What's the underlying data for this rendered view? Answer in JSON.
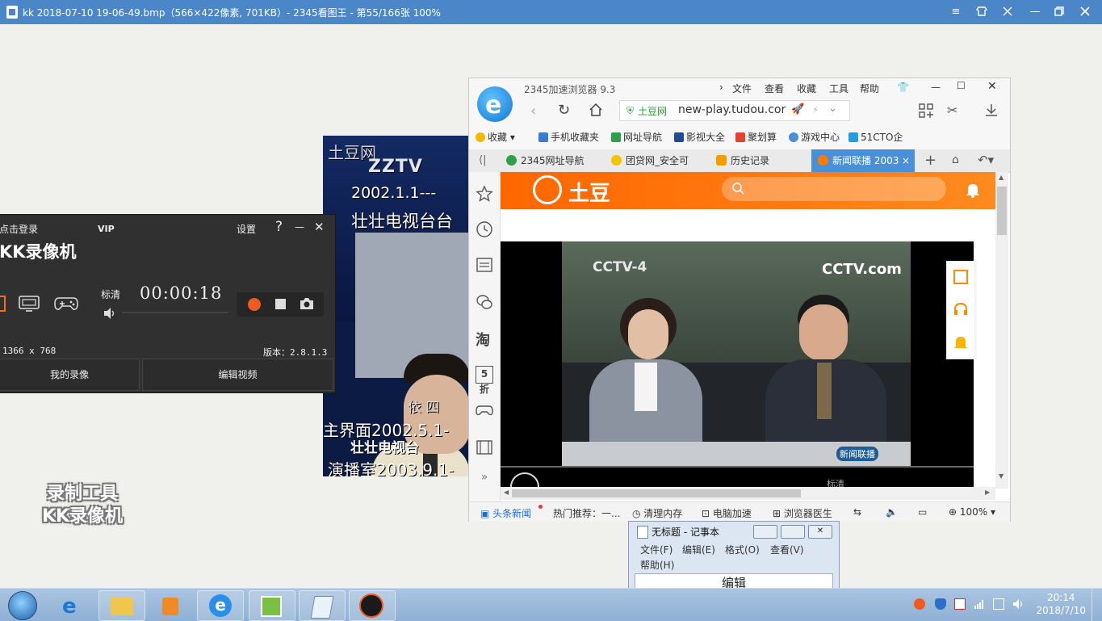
{
  "viewer": {
    "title": "kk 2018-07-10 19-06-49.bmp（566×422像素, 701KB）- 2345看图王 - 第55/166张 100%"
  },
  "zztv": {
    "logo_text": "土豆网",
    "channel_logo": "ZZTV",
    "line1": "2002.1.1---",
    "line2": "壮壮电视台台",
    "line3": "主界面2002.5.1-",
    "line4": "演播室2003.9.1-",
    "desk_sign": "壮壮电视台",
    "desk_name": "依 四"
  },
  "kk": {
    "login": "点击登录",
    "vip": "VIP",
    "settings": "设置",
    "help": "?",
    "minimize": "—",
    "close": "✕",
    "brand": "KK录像机",
    "quality": "标清",
    "timer": "00:00:18",
    "resolution": "1366 x 768",
    "version": "版本：2.8.1.3",
    "my_recordings": "我的录像",
    "edit_video": "编辑视频"
  },
  "watermark": {
    "line1": "录制工具",
    "line2": "KK录像机"
  },
  "browser": {
    "title": "2345加速浏览器 9.3",
    "menu": [
      "文件",
      "查看",
      "收藏",
      "工具",
      "帮助"
    ],
    "address_site": "土豆网",
    "address_url": "new-play.tudou.cor",
    "bookmarks": [
      "收藏",
      "手机收藏夹",
      "网址导航",
      "影视大全",
      "聚划算",
      "游戏中心",
      "51CTO企"
    ],
    "tabs": [
      "2345网址导航",
      "团贷网_安全可",
      "历史记录",
      "新闻联播 2003"
    ],
    "tudou_logo": "土豆",
    "video_logo_left": "CCTV-4",
    "video_logo_right": "CCTV.com",
    "video_caption": "新闻联播",
    "video_quality": "标清",
    "status": {
      "news": "头条新闻",
      "hot": "热门推荐：一...",
      "clean": "清理内存",
      "speedup": "电脑加速",
      "doctor": "浏览器医生",
      "zoom": "100%"
    }
  },
  "notepad": {
    "title": "无标题 - 记事本",
    "menu": [
      "文件(F)",
      "编辑(E)",
      "格式(O)",
      "查看(V)",
      "帮助(H)"
    ],
    "content": "编辑"
  },
  "taskbar": {
    "time": "20:14",
    "date": "2018/7/10"
  },
  "colors": {
    "viewer_title": "#4a86c8",
    "kk_bg": "#303030",
    "record_red": "#f05a1e",
    "tudou_orange": "#ff7a00"
  }
}
